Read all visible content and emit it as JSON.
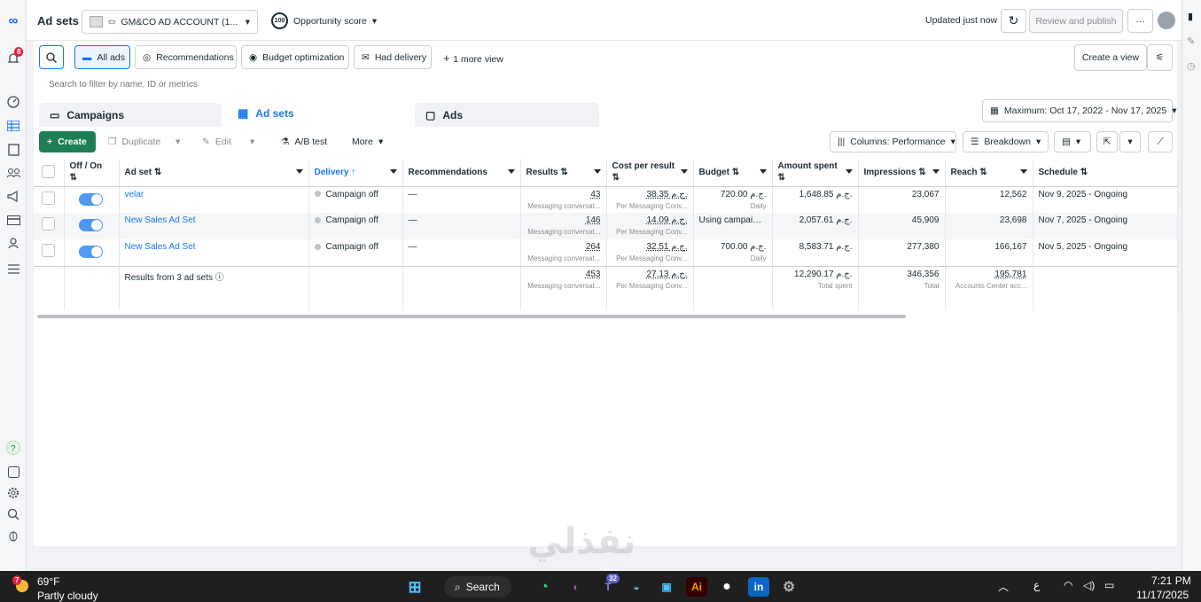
{
  "topbar": {
    "title": "Ad sets",
    "account": "GM&CO AD ACCOUNT (1...",
    "opportunity_score": "100",
    "opportunity_label": "Opportunity score",
    "updated": "Updated just now",
    "review_publish": "Review and publish",
    "more": "···"
  },
  "notifications_count": "8",
  "views": {
    "all_ads": "All ads",
    "recommendations": "Recommendations",
    "budget_opt": "Budget optimization",
    "had_delivery": "Had delivery",
    "more_view": "1 more view",
    "create_view": "Create a view"
  },
  "search": {
    "placeholder": "Search to filter by name, ID or metrics"
  },
  "tabs": {
    "campaigns": "Campaigns",
    "ad_sets": "Ad sets",
    "ads": "Ads"
  },
  "date_range": "Maximum: Oct 17, 2022 - Nov 17, 2025",
  "toolbar": {
    "create": "Create",
    "duplicate": "Duplicate",
    "edit": "Edit",
    "ab_test": "A/B test",
    "more": "More",
    "columns": "Columns: Performance",
    "breakdown": "Breakdown"
  },
  "columns": {
    "onoff": "Off / On",
    "adset": "Ad set",
    "delivery": "Delivery",
    "recommendations": "Recommendations",
    "results": "Results",
    "cpr": "Cost per result",
    "budget": "Budget",
    "amount": "Amount spent",
    "impressions": "Impressions",
    "reach": "Reach",
    "schedule": "Schedule"
  },
  "rows": [
    {
      "name": "velar",
      "delivery": "Campaign off",
      "recs": "—",
      "results": "43",
      "results_sub": "Messaging conversat...",
      "cpr": "38.35 ج.م.",
      "cpr_sub": "Per Messaging Conv...",
      "budget": "720.00 ج.م.",
      "budget_sub": "Daily",
      "amount": "1,648.85 ج.م.",
      "impressions": "23,067",
      "reach": "12,562",
      "schedule": "Nov 9, 2025 - Ongoing"
    },
    {
      "name": "New Sales Ad Set",
      "delivery": "Campaign off",
      "recs": "—",
      "results": "146",
      "results_sub": "Messaging conversat...",
      "cpr": "14.09 ج.م.",
      "cpr_sub": "Per Messaging Conv...",
      "budget": "Using campaign...",
      "budget_sub": "",
      "amount": "2,057.61 ج.م.",
      "impressions": "45,909",
      "reach": "23,698",
      "schedule": "Nov 7, 2025 - Ongoing"
    },
    {
      "name": "New Sales Ad Set",
      "delivery": "Campaign off",
      "recs": "—",
      "results": "264",
      "results_sub": "Messaging conversat...",
      "cpr": "32.51 ج.م.",
      "cpr_sub": "Per Messaging Conv...",
      "budget": "700.00 ج.م.",
      "budget_sub": "Daily",
      "amount": "8,583.71 ج.م.",
      "impressions": "277,380",
      "reach": "166,167",
      "schedule": "Nov 5, 2025 - Ongoing"
    }
  ],
  "total": {
    "label": "Results from 3 ad sets",
    "results": "453",
    "results_sub": "Messaging conversat...",
    "cpr": "27.13 ج.م.",
    "cpr_sub": "Per Messaging Conv...",
    "amount": "12,290.17 ج.م.",
    "amount_sub": "Total spent",
    "impressions": "346,356",
    "impressions_sub": "Total",
    "reach": "195,781",
    "reach_sub": "Accounts Center acc..."
  },
  "taskbar": {
    "weather_badge": "7",
    "temp": "69°F",
    "weather": "Partly cloudy",
    "search": "Search",
    "tray_lang": "ع",
    "time": "7:21 PM",
    "date": "11/17/2025",
    "teams_badge": "32"
  },
  "watermark": "نفذلي"
}
